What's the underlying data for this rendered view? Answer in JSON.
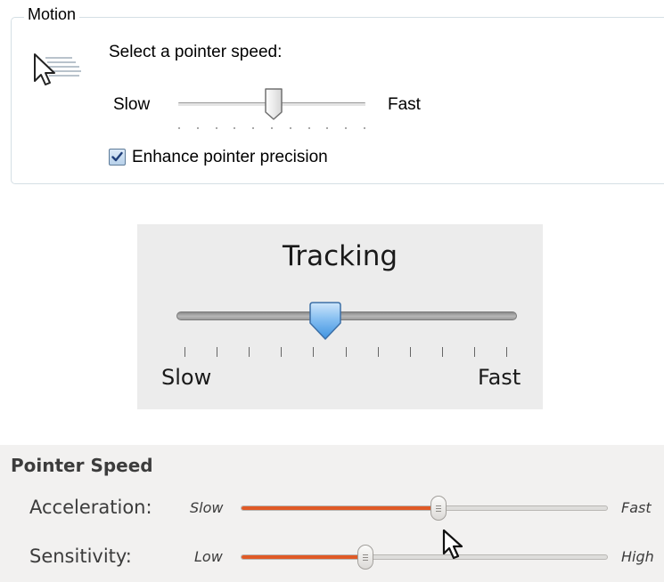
{
  "windows": {
    "group_title": "Motion",
    "prompt": "Select a pointer speed:",
    "slow_label": "Slow",
    "fast_label": "Fast",
    "speed_fraction": 0.5,
    "tick_count": 11,
    "checkbox_label": "Enhance pointer precision",
    "checkbox_checked": true,
    "icon": "pointer-speed-icon"
  },
  "mac": {
    "title": "Tracking",
    "slow_label": "Slow",
    "fast_label": "Fast",
    "speed_fraction": 0.45,
    "tick_count": 11
  },
  "ubuntu": {
    "title": "Pointer Speed",
    "accent_color": "#e05a26",
    "rows": [
      {
        "label": "Acceleration:",
        "min_label": "Slow",
        "max_label": "Fast",
        "value_fraction": 0.54
      },
      {
        "label": "Sensitivity:",
        "min_label": "Low",
        "max_label": "High",
        "value_fraction": 0.34
      }
    ]
  }
}
